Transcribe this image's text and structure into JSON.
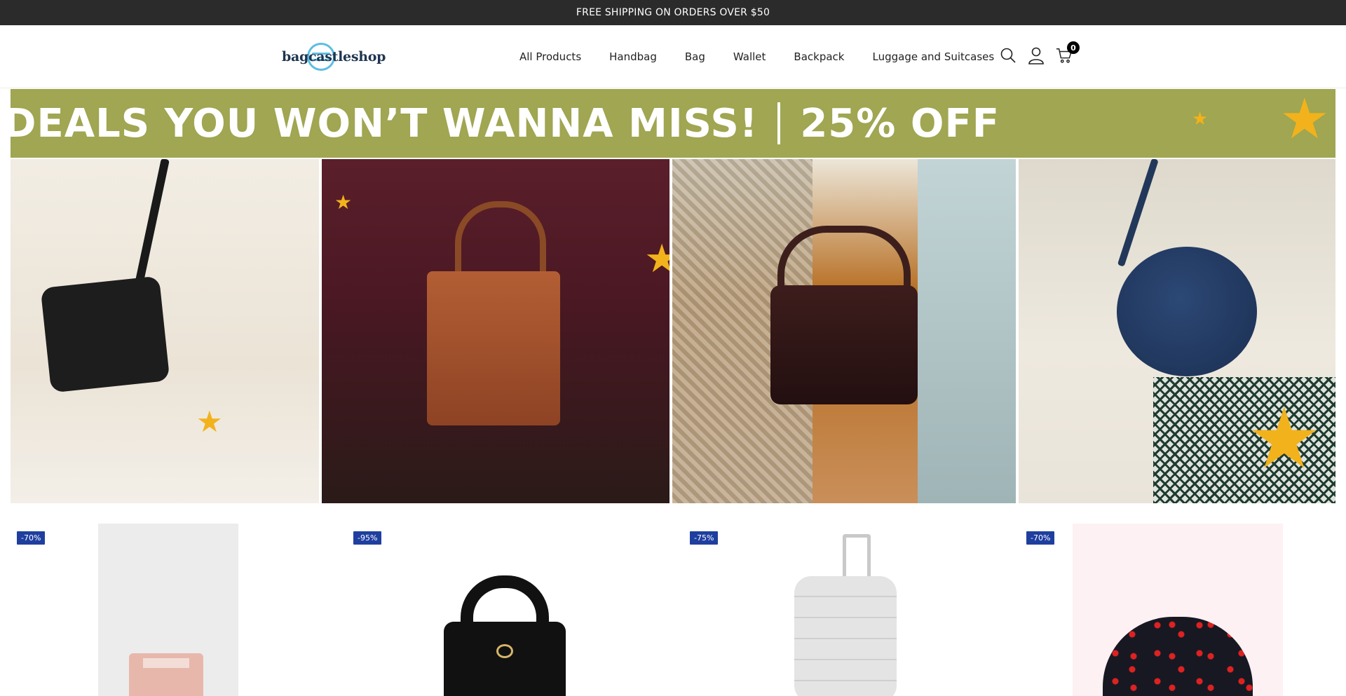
{
  "announcement": "FREE SHIPPING ON ORDERS OVER $50",
  "logo": {
    "text": "bagcastleshop"
  },
  "nav": [
    "All Products",
    "Handbag",
    "Bag",
    "Wallet",
    "Backpack",
    "Luggage and Suitcases"
  ],
  "header_icons": [
    "search-icon",
    "user-icon",
    "cart-icon"
  ],
  "cart_count": "0",
  "hero": {
    "headline": "DEALS YOU WON’T WANNA MISS!",
    "discount": "25% OFF",
    "banner_color": "#a0a651",
    "star_color": "#f2b21c"
  },
  "products": [
    {
      "badge": "-70%"
    },
    {
      "badge": "-95%"
    },
    {
      "badge": "-75%"
    },
    {
      "badge": "-70%"
    }
  ],
  "colors": {
    "announcement_bg": "#2b2b2b",
    "badge_bg": "#1f3f9f"
  }
}
